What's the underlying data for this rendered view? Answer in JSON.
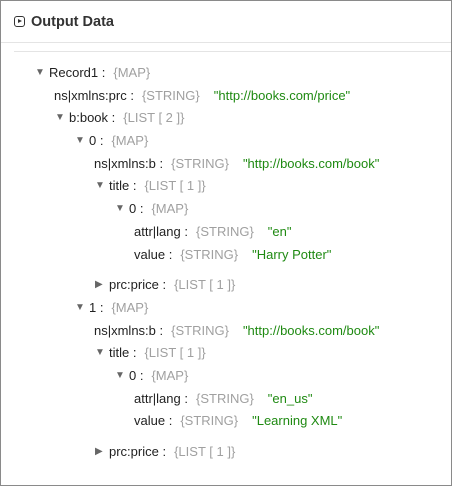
{
  "header": {
    "title": "Output Data",
    "icon": "play-square-icon"
  },
  "rows": [
    {
      "level": 0,
      "toggle": "expanded",
      "key": "Record1",
      "type": "{MAP}"
    },
    {
      "level": 1,
      "key": "ns|xmlns:prc",
      "type": "{STRING}",
      "value": "\"http://books.com/price\""
    },
    {
      "level": 1,
      "toggle": "expanded",
      "key": "b:book",
      "type": "{LIST [ 2 ]}"
    },
    {
      "level": 2,
      "toggle": "expanded",
      "key": "0",
      "type": "{MAP}"
    },
    {
      "level": 3,
      "key": "ns|xmlns:b",
      "type": "{STRING}",
      "value": "\"http://books.com/book\""
    },
    {
      "level": 3,
      "toggle": "expanded",
      "key": "title",
      "type": "{LIST [ 1 ]}"
    },
    {
      "level": 4,
      "toggle": "expanded",
      "key": "0",
      "type": "{MAP}"
    },
    {
      "level": 5,
      "key": "attr|lang",
      "type": "{STRING}",
      "value": "\"en\""
    },
    {
      "level": 5,
      "key": "value",
      "type": "{STRING}",
      "value": "\"Harry Potter\""
    },
    {
      "level": 3,
      "toggle": "collapsed",
      "key": "prc:price",
      "type": "{LIST [ 1 ]}",
      "gap": true
    },
    {
      "level": 2,
      "toggle": "expanded",
      "key": "1",
      "type": "{MAP}"
    },
    {
      "level": 3,
      "key": "ns|xmlns:b",
      "type": "{STRING}",
      "value": "\"http://books.com/book\""
    },
    {
      "level": 3,
      "toggle": "expanded",
      "key": "title",
      "type": "{LIST [ 1 ]}"
    },
    {
      "level": 4,
      "toggle": "expanded",
      "key": "0",
      "type": "{MAP}"
    },
    {
      "level": 5,
      "key": "attr|lang",
      "type": "{STRING}",
      "value": "\"en_us\""
    },
    {
      "level": 5,
      "key": "value",
      "type": "{STRING}",
      "value": "\"Learning XML\""
    },
    {
      "level": 3,
      "toggle": "collapsed",
      "key": "prc:price",
      "type": "{LIST [ 1 ]}",
      "gap": true
    }
  ]
}
